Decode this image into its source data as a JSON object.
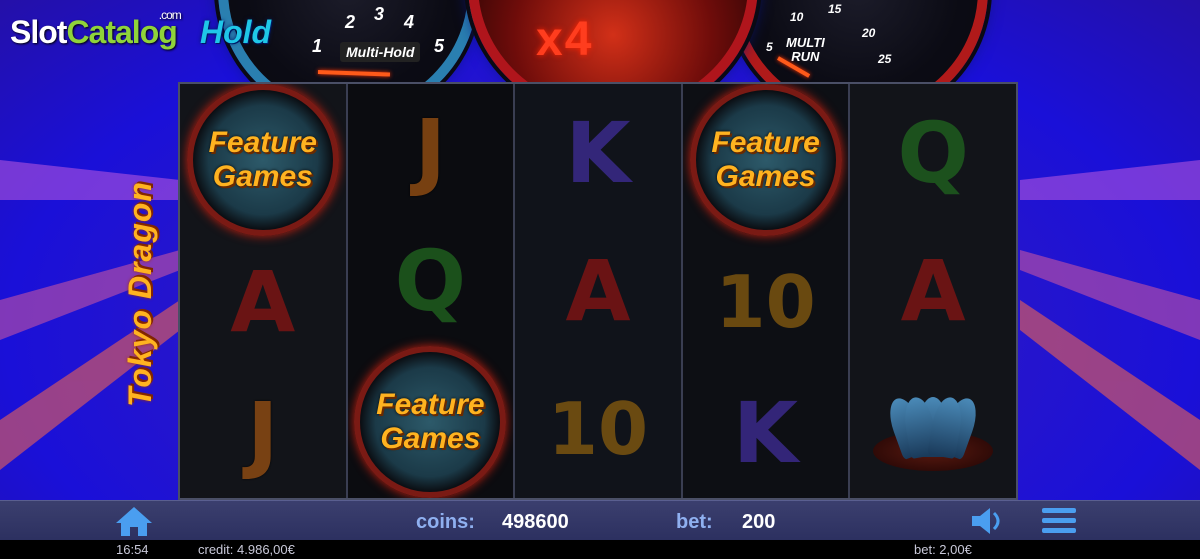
{
  "logo": {
    "slot": "Slot",
    "catalog": "Catalog",
    "com": ".com"
  },
  "header": {
    "game_badge": "Hold",
    "multi_hold_label": "Multi-Hold",
    "multi_hold_numbers": [
      "1",
      "2",
      "3",
      "4",
      "5"
    ],
    "multiplier": "x4",
    "multi_run_label": [
      "MULTI",
      "RUN"
    ],
    "multi_run_numbers": [
      "5",
      "10",
      "15",
      "20",
      "25"
    ]
  },
  "side_title": "Tokyo Dragon",
  "reels": [
    [
      {
        "type": "feature",
        "label": [
          "Feature",
          "Games"
        ]
      },
      {
        "type": "A",
        "label": "A"
      },
      {
        "type": "J",
        "label": "J"
      }
    ],
    [
      {
        "type": "J",
        "label": "J"
      },
      {
        "type": "Q",
        "label": "Q"
      },
      {
        "type": "feature",
        "label": [
          "Feature",
          "Games"
        ]
      }
    ],
    [
      {
        "type": "K",
        "label": "K"
      },
      {
        "type": "A",
        "label": "A"
      },
      {
        "type": "T",
        "label": "10"
      }
    ],
    [
      {
        "type": "feature",
        "label": [
          "Feature",
          "Games"
        ]
      },
      {
        "type": "T",
        "label": "10"
      },
      {
        "type": "K",
        "label": "K"
      }
    ],
    [
      {
        "type": "Q",
        "label": "Q"
      },
      {
        "type": "A",
        "label": "A"
      },
      {
        "type": "lotus",
        "label": ""
      }
    ]
  ],
  "bar": {
    "coins_label": "coins:",
    "coins_value": "498600",
    "bet_label": "bet:",
    "bet_value": "200"
  },
  "bottom": {
    "time": "16:54",
    "credit": "credit: 4.986,00€",
    "bet": "bet: 2,00€"
  },
  "icons": {
    "home": "home-icon",
    "sound": "speaker-icon",
    "menu": "menu-icon"
  },
  "colors": {
    "accent_gold": "#ffb320",
    "multiplier_red": "#ff3d1e",
    "label_blue": "#8fb0f0"
  }
}
